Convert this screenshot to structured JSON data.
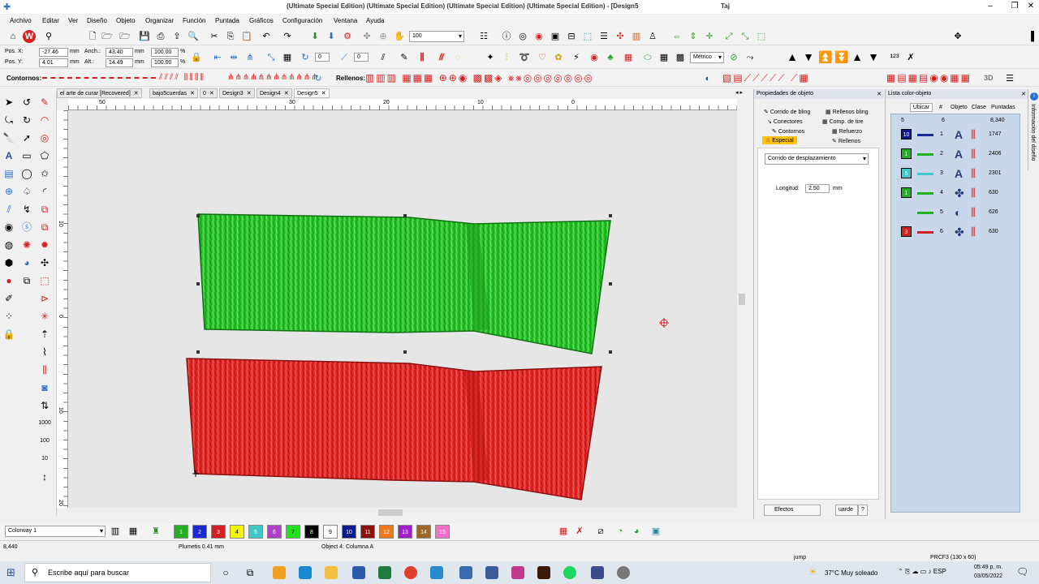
{
  "window": {
    "title": "(Ultimate Special Edition) (Ultimate Special Edition) (Ultimate Special Edition) (Ultimate Special Edition) - [Design5",
    "title_suffix": "Taj"
  },
  "menu": [
    "Archivo",
    "Editar",
    "Ver",
    "Diseño",
    "Objeto",
    "Organizar",
    "Función",
    "Puntada",
    "Gráficos",
    "Configuración",
    "Ventana",
    "Ayuda"
  ],
  "toolbar1": {
    "zoom_value": "100"
  },
  "toolbar2": {
    "pos_x_label": "Pos. X:",
    "pos_x": "-27.46",
    "pos_x_unit": "mm",
    "pos_y_label": "Pos. Y:",
    "pos_y": "4.01",
    "pos_y_unit": "mm",
    "width_label": "Anch.:",
    "width": "43.40",
    "width_unit": "mm",
    "height_label": "Alt.:",
    "height": "14.49",
    "height_unit": "mm",
    "scale_w": "100.00",
    "scale_h": "100.00",
    "percent": "%",
    "rotate": "0",
    "slant": "0",
    "units_select": "Métrico"
  },
  "toolbar3": {
    "contornos_label": "Contornos:",
    "rellenos_label": "Rellenos:",
    "threed_label": "3D"
  },
  "tabs": [
    {
      "label": "el arte de curar [Recovered]",
      "active": false
    },
    {
      "label": "bajo5cuerdas",
      "active": false
    },
    {
      "label": "0",
      "active": false
    },
    {
      "label": "Design3",
      "active": false
    },
    {
      "label": "Design4",
      "active": false
    },
    {
      "label": "Design5",
      "active": true
    }
  ],
  "ruler_h": [
    "50",
    "40",
    "30",
    "20",
    "10",
    "0"
  ],
  "ruler_v": [
    "10",
    "0",
    "10",
    "20",
    "30"
  ],
  "props": {
    "header": "Propiedades de objeto",
    "tabs": [
      {
        "label": "Corrido de bling",
        "active": false
      },
      {
        "label": "Rellenos bling",
        "active": false
      },
      {
        "label": "Conectores",
        "active": false
      },
      {
        "label": "Comp. de tire",
        "active": false
      },
      {
        "label": "Contornos",
        "active": false
      },
      {
        "label": "Refuerzo",
        "active": false
      },
      {
        "label": "Especial",
        "active": true
      },
      {
        "label": "Rellenos",
        "active": false
      }
    ],
    "type_select": "Corrido de desplazamiento",
    "length_label": "Longitud:",
    "length_value": "2.50",
    "length_unit": "mm",
    "effects_button": "Efectos",
    "save_button": "uarde",
    "help_button": "?"
  },
  "color_list": {
    "header": "Lista color-objeto",
    "locate_button": "Ubicar",
    "col_num": "#",
    "col_object": "Objeto",
    "col_class": "Clase",
    "col_stitches": "Puntadas",
    "summary": {
      "colors": "5",
      "objects": "6",
      "stitches": "8,340"
    },
    "rows": [
      {
        "swatch": "10",
        "swatch_color": "#0a1a8c",
        "line_color": "#1a2a9c",
        "num": "1",
        "stitches": "1747"
      },
      {
        "swatch": "1",
        "swatch_color": "#22b022",
        "line_color": "#22b022",
        "num": "2",
        "stitches": "2406"
      },
      {
        "swatch": "5",
        "swatch_color": "#40c8c8",
        "line_color": "#40c8c8",
        "num": "3",
        "stitches": "2301"
      },
      {
        "swatch": "1",
        "swatch_color": "#22b022",
        "line_color": "#22b022",
        "num": "4",
        "stitches": "630"
      },
      {
        "swatch": "",
        "swatch_color": "#22b022",
        "line_color": "#22b022",
        "num": "5",
        "stitches": "626"
      },
      {
        "swatch": "3",
        "swatch_color": "#d42020",
        "line_color": "#d42020",
        "num": "6",
        "stitches": "630"
      }
    ]
  },
  "infotab_label": "Información del diseño",
  "colorway": {
    "select": "Colorway 1",
    "swatches": [
      {
        "label": "1",
        "color": "#22b022"
      },
      {
        "label": "2",
        "color": "#1a2ad0"
      },
      {
        "label": "3",
        "color": "#d42020"
      },
      {
        "label": "4",
        "color": "#f5f500"
      },
      {
        "label": "5",
        "color": "#40c8c8"
      },
      {
        "label": "6",
        "color": "#b040c8"
      },
      {
        "label": "7",
        "color": "#22e022"
      },
      {
        "label": "8",
        "color": "#000000"
      },
      {
        "label": "9",
        "color": "#ffffff"
      },
      {
        "label": "10",
        "color": "#0a1a8c"
      },
      {
        "label": "11",
        "color": "#8c1010"
      },
      {
        "label": "12",
        "color": "#f07818"
      },
      {
        "label": "13",
        "color": "#a020c8"
      },
      {
        "label": "14",
        "color": "#a06828"
      },
      {
        "label": "15",
        "color": "#f070c8"
      }
    ]
  },
  "status": {
    "stitch_count": "8,440",
    "plumetis": "Plumetis 0.41 mm",
    "object_info": "Object 4: Columna A",
    "jump": "jump",
    "hoop": "PRCF3 (130 x 60)"
  },
  "taskbar": {
    "search_placeholder": "Escribe aquí para buscar",
    "weather": "37°C  Muy soleado",
    "time": "05:49 p. m.",
    "date": "03/05/2022"
  }
}
